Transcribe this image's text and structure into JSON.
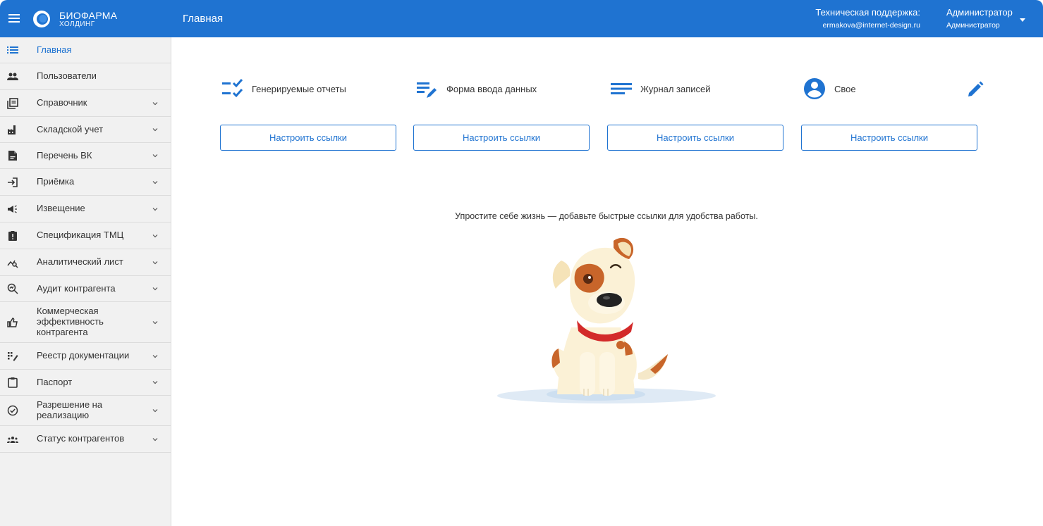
{
  "header": {
    "logo_line1": "БИОФАРМА",
    "logo_line2": "ХОЛДИНГ",
    "page_title": "Главная",
    "support_label": "Техническая поддержка:",
    "support_email": "ermakova@internet-design.ru",
    "user_name": "Администратор",
    "user_role": "Администратор",
    "accent_color": "#1f73d1"
  },
  "sidebar": {
    "items": [
      {
        "label": "Главная",
        "icon": "list-icon",
        "active": true
      },
      {
        "label": "Пользователи",
        "icon": "people-icon"
      },
      {
        "label": "Справочник",
        "icon": "library-icon"
      },
      {
        "label": "Складской учет",
        "icon": "factory-icon"
      },
      {
        "label": "Перечень ВК",
        "icon": "document-icon"
      },
      {
        "label": "Приёмка",
        "icon": "login-icon"
      },
      {
        "label": "Извещение",
        "icon": "campaign-icon"
      },
      {
        "label": "Спецификация ТМЦ",
        "icon": "clipboard-alert-icon"
      },
      {
        "label": "Аналитический лист",
        "icon": "analytics-search-icon"
      },
      {
        "label": "Аудит контрагента",
        "icon": "zoom-audit-icon"
      },
      {
        "label": "Коммерческая эффективность контрагента",
        "icon": "thumb-up-icon"
      },
      {
        "label": "Реестр документации",
        "icon": "registry-icon"
      },
      {
        "label": "Паспорт",
        "icon": "clipboard-icon"
      },
      {
        "label": "Разрешение на реализацию",
        "icon": "check-circle-icon"
      },
      {
        "label": "Статус контрагентов",
        "icon": "groups-icon"
      }
    ]
  },
  "main": {
    "quick_links": [
      {
        "label": "Генерируемые отчеты",
        "icon": "checklist-icon",
        "button": "Настроить ссылки"
      },
      {
        "label": "Форма ввода данных",
        "icon": "edit-note-icon",
        "button": "Настроить ссылки"
      },
      {
        "label": "Журнал записей",
        "icon": "notes-icon",
        "button": "Настроить ссылки"
      },
      {
        "label": "Свое",
        "icon": "account-circle-icon",
        "button": "Настроить ссылки"
      }
    ],
    "edit_icon": "pencil-icon",
    "hint": "Упростите себе жизнь — добавьте быстрые ссылки для удобства работы.",
    "illustration": "dog-illustration"
  }
}
